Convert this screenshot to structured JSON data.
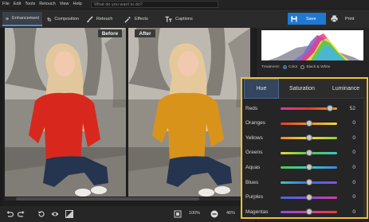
{
  "menu": [
    "File",
    "Edit",
    "Tools",
    "Retouch",
    "View",
    "Help"
  ],
  "search": {
    "placeholder": "What do you want to do?"
  },
  "tabs": [
    {
      "label": "Enhancement",
      "icon": "sliders-icon",
      "active": true
    },
    {
      "label": "Composition",
      "icon": "crop-icon",
      "active": false
    },
    {
      "label": "Retouch",
      "icon": "brush-icon",
      "active": false
    },
    {
      "label": "Effects",
      "icon": "magic-wand-icon",
      "active": false
    },
    {
      "label": "Captions",
      "icon": "text-icon",
      "active": false
    }
  ],
  "actions": {
    "save": "Save",
    "print": "Print"
  },
  "viewer": {
    "before_label": "Before",
    "after_label": "After"
  },
  "bottom": {
    "zoom": "100%",
    "scale": "46%"
  },
  "panel": {
    "treatment_label": "Treatment:",
    "color_label": "Color",
    "bw_label": "Black & White",
    "color_selected": true
  },
  "hsl": {
    "tabs": [
      {
        "label": "Hue",
        "active": true
      },
      {
        "label": "Saturation",
        "active": false
      },
      {
        "label": "Luminance",
        "active": false
      }
    ],
    "rows": [
      {
        "label": "Reds",
        "value": "52",
        "level": 0.88
      },
      {
        "label": "Oranges",
        "value": "0",
        "level": 0.5
      },
      {
        "label": "Yellows",
        "value": "0",
        "level": 0.5
      },
      {
        "label": "Greens",
        "value": "0",
        "level": 0.5
      },
      {
        "label": "Aquas",
        "value": "0",
        "level": 0.5
      },
      {
        "label": "Blues",
        "value": "0",
        "level": 0.5
      },
      {
        "label": "Purples",
        "value": "0",
        "level": 0.5
      },
      {
        "label": "Magentas",
        "value": "0",
        "level": 0.5
      }
    ]
  },
  "colors": {
    "accent": "#1f78d1",
    "highlight_border": "#f2c232",
    "sweater_before": "#d8281e",
    "sweater_after": "#d8931a"
  }
}
